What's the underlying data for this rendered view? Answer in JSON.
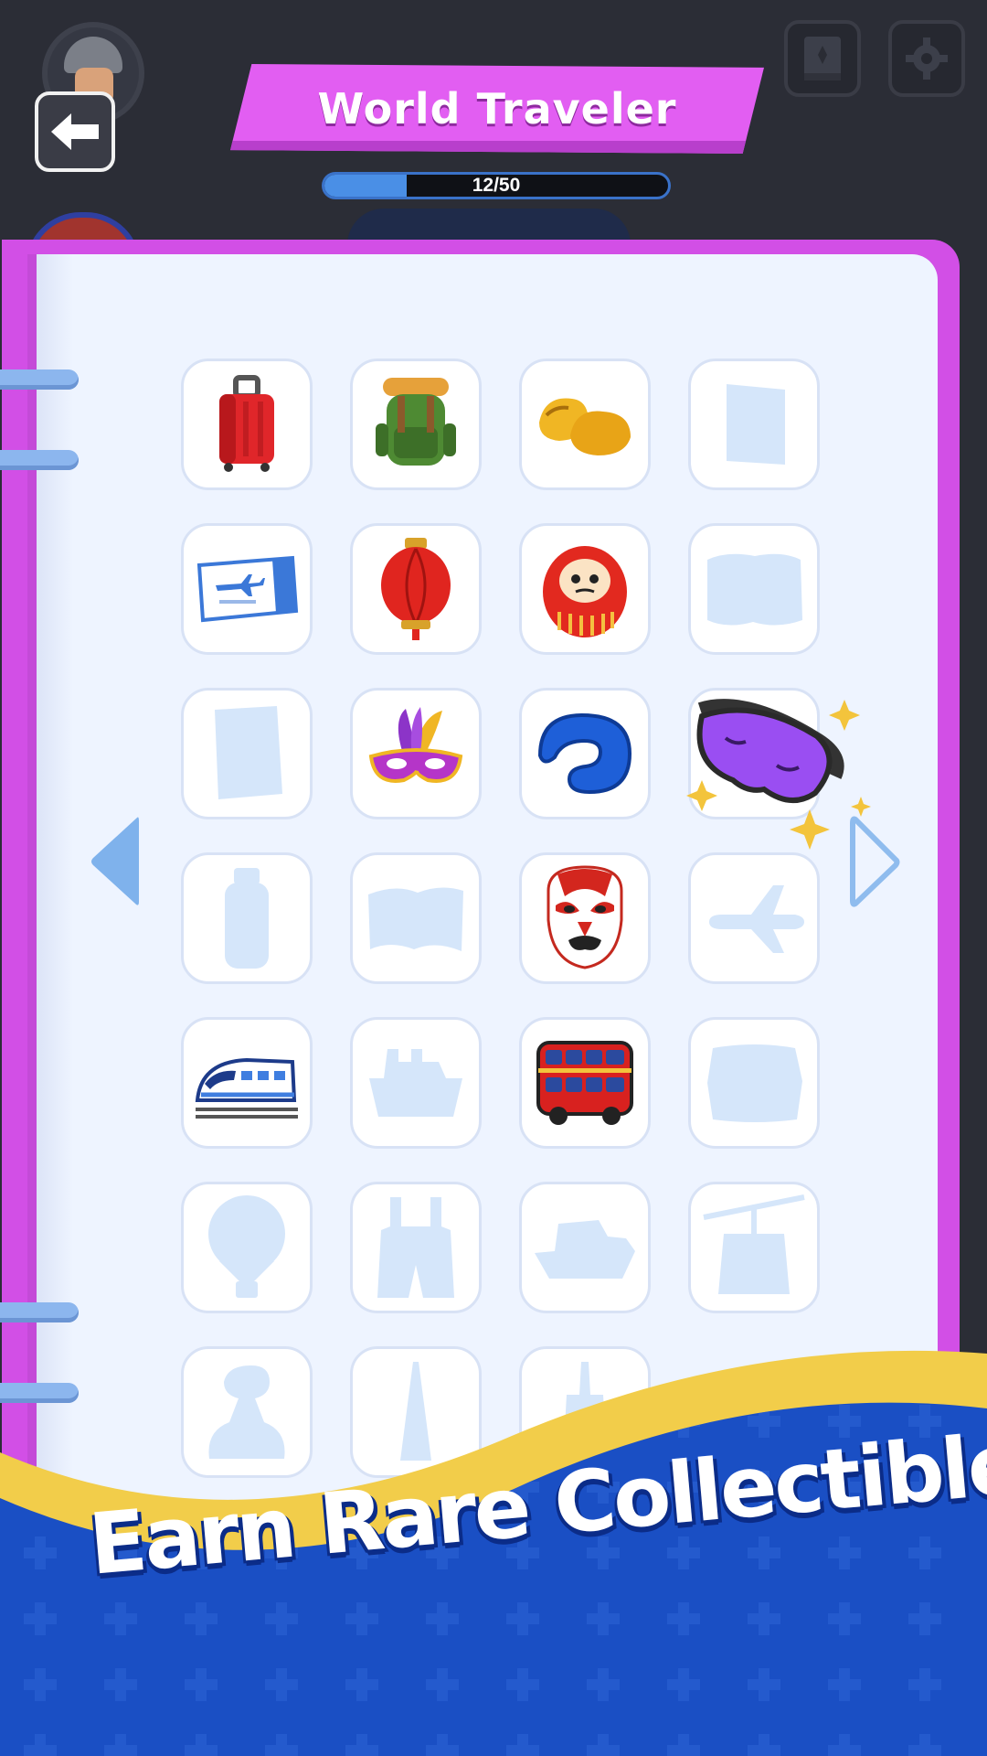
{
  "header": {
    "title": "World Traveler",
    "progress_text": "12/50",
    "progress_fraction": 0.24,
    "back_icon": "arrow-left-icon",
    "book_icon": "book-icon",
    "settings_icon": "gear-icon"
  },
  "album": {
    "rows": [
      [
        "suitcase",
        "backpack",
        "wooden-clogs",
        "locked"
      ],
      [
        "plane-ticket",
        "paper-lantern",
        "daruma-doll",
        "locked"
      ],
      [
        "locked",
        "carnival-mask",
        "neck-pillow",
        "sleep-mask"
      ],
      [
        "locked",
        "locked",
        "opera-mask",
        "locked"
      ],
      [
        "bullet-train",
        "locked",
        "double-decker-bus",
        "locked"
      ],
      [
        "locked",
        "locked",
        "locked",
        "locked"
      ],
      [
        "locked",
        "locked",
        "locked"
      ]
    ],
    "prev_icon": "arrow-left-triangle-icon",
    "next_icon": "arrow-right-triangle-icon"
  },
  "promo": {
    "tagline": "Earn Rare Collectibles!"
  },
  "colors": {
    "background": "#2b2d36",
    "banner": "#e25ef2",
    "album_border": "#d24fe6",
    "page": "#eef4ff",
    "wave_yellow": "#f2cd4a",
    "wave_blue": "#1a4fc4"
  }
}
